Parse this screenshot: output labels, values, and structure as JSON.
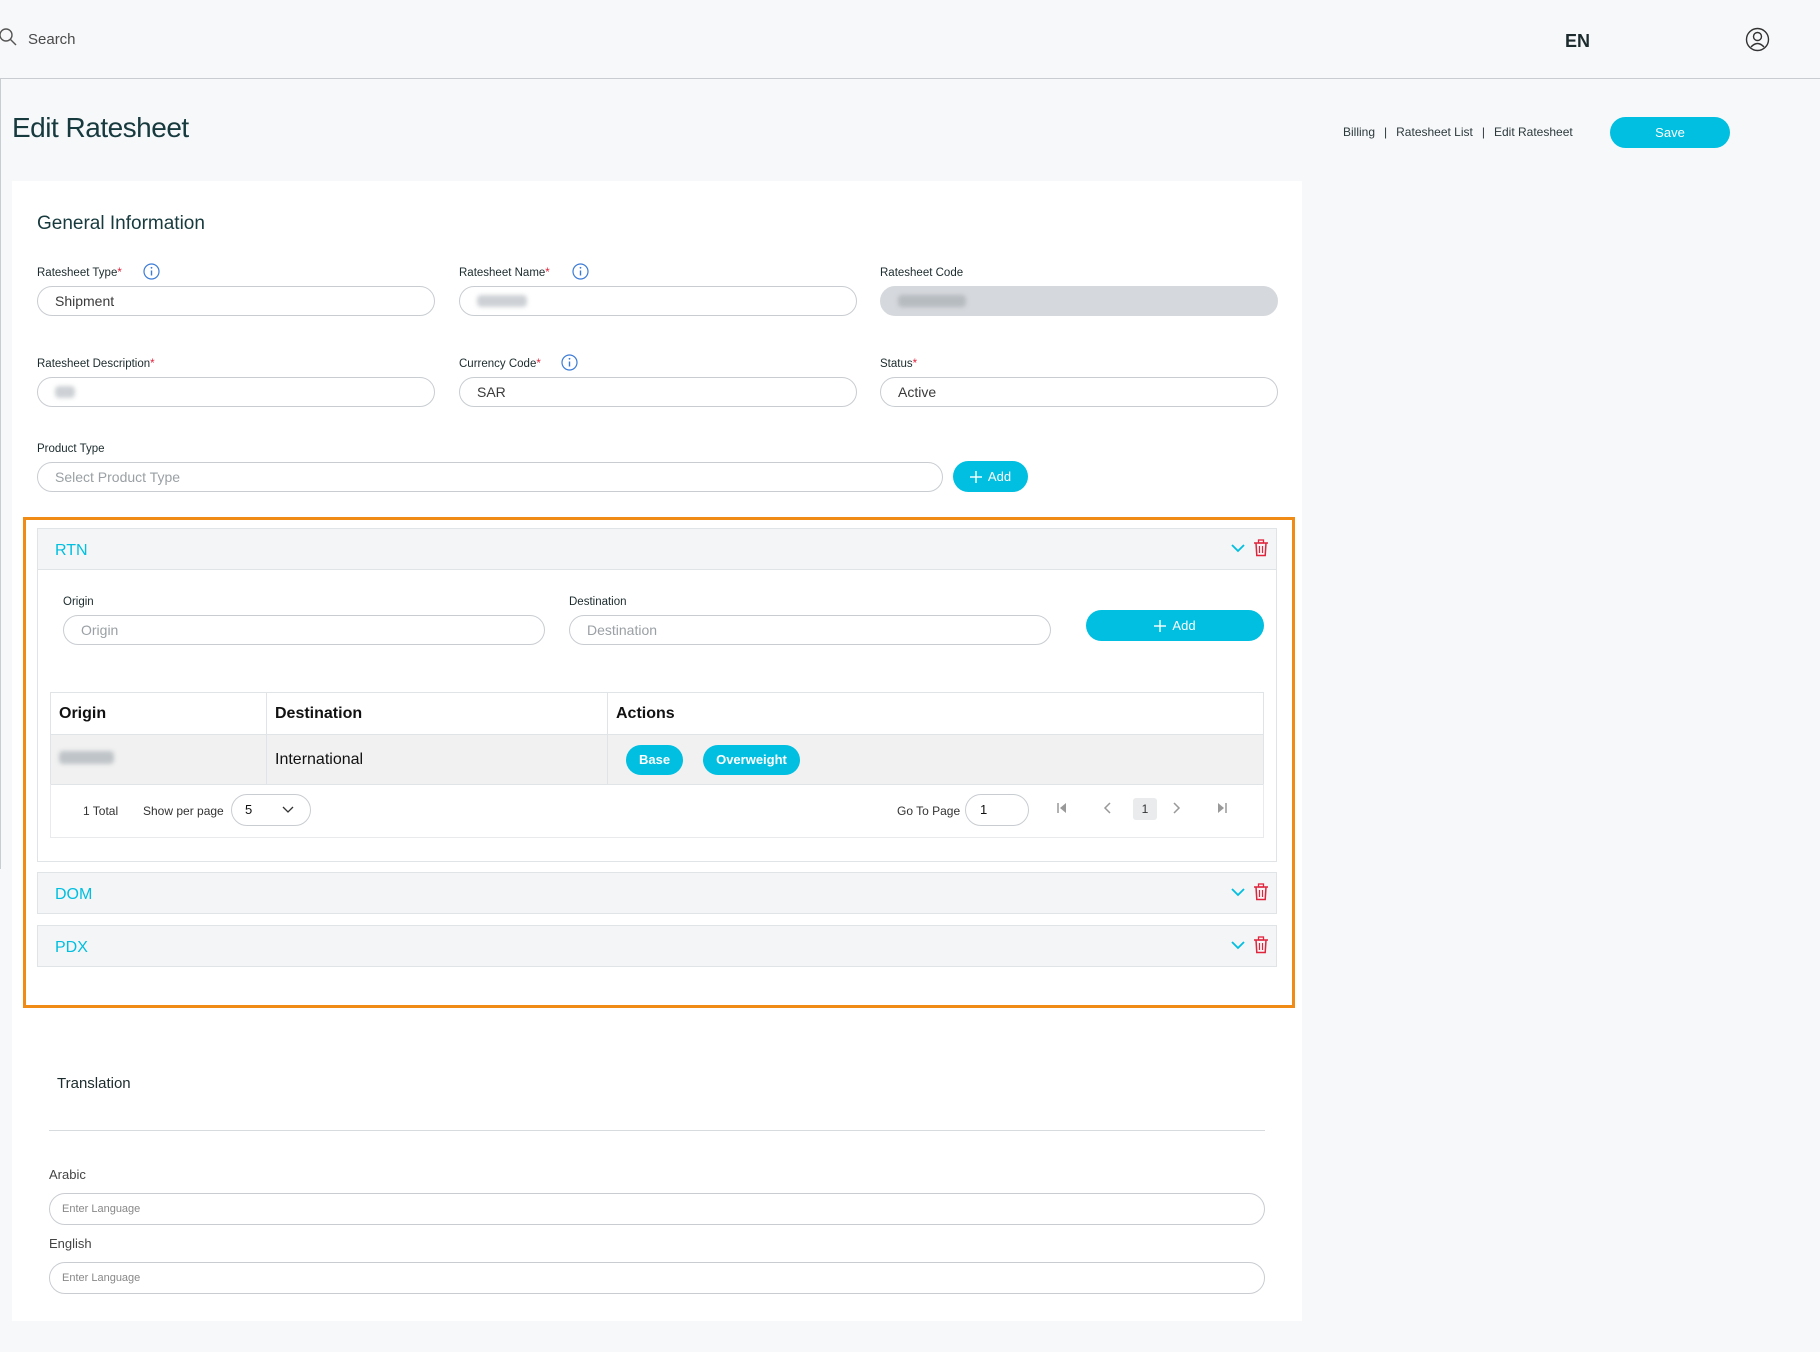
{
  "header": {
    "search_placeholder": "Search",
    "language": "EN"
  },
  "page": {
    "title": "Edit Ratesheet",
    "save_label": "Save",
    "breadcrumb": [
      "Billing",
      "Ratesheet List",
      "Edit Ratesheet"
    ],
    "breadcrumb_sep": "|"
  },
  "general": {
    "title": "General Information",
    "ratesheet_type": {
      "label": "Ratesheet Type",
      "value": "Shipment"
    },
    "ratesheet_name": {
      "label": "Ratesheet Name"
    },
    "ratesheet_code": {
      "label": "Ratesheet Code"
    },
    "ratesheet_description": {
      "label": "Ratesheet Description"
    },
    "currency_code": {
      "label": "Currency Code",
      "value": "SAR"
    },
    "status": {
      "label": "Status",
      "value": "Active"
    },
    "product_type": {
      "label": "Product Type",
      "placeholder": "Select Product Type",
      "add_label": "Add"
    },
    "required_mark": "*"
  },
  "products": [
    {
      "name": "RTN",
      "expanded": true,
      "origin_label": "Origin",
      "origin_placeholder": "Origin",
      "destination_label": "Destination",
      "destination_placeholder": "Destination",
      "add_label": "Add",
      "table": {
        "columns": [
          "Origin",
          "Destination",
          "Actions"
        ],
        "rows": [
          {
            "destination": "International",
            "actions": [
              "Base",
              "Overweight"
            ]
          }
        ]
      },
      "pagination": {
        "total": "1 Total",
        "per_page_label": "Show per page",
        "per_page_value": "5",
        "goto_label": "Go To Page",
        "goto_value": "1",
        "current_page": "1"
      }
    },
    {
      "name": "DOM",
      "expanded": false
    },
    {
      "name": "PDX",
      "expanded": false
    }
  ],
  "translation": {
    "title": "Translation",
    "arabic_label": "Arabic",
    "english_label": "English",
    "placeholder": "Enter Language"
  },
  "colors": {
    "accent": "#00bfe0",
    "highlight": "#f08c16",
    "danger": "#e0243c"
  }
}
